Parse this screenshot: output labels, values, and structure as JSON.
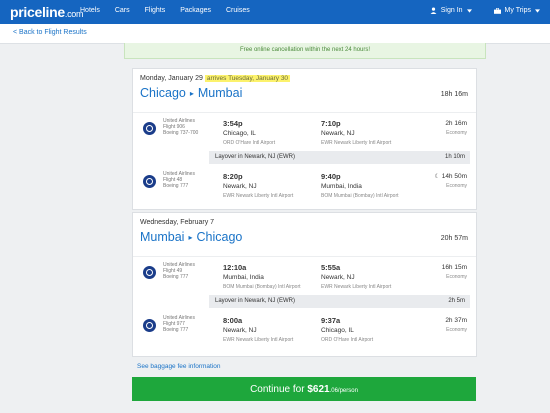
{
  "topbar": {
    "logo": "priceline",
    "logo_suffix": ".com",
    "nav": [
      "Hotels",
      "Cars",
      "Flights",
      "Packages",
      "Cruises"
    ],
    "sign_in": "Sign In",
    "my_trips": "My Trips",
    "color": "#1565c0"
  },
  "subbar": {
    "back": "< Back to Flight Results"
  },
  "notice": "Free online cancellation within the next 24 hours!",
  "trips": [
    {
      "date": "Monday, January 29",
      "arrives": "arrives Tuesday, January 30",
      "from": "Chicago",
      "to": "Mumbai",
      "total": "18h 16m",
      "segments": [
        {
          "airline": "United Airlines",
          "flight": "Flight 906",
          "aircraft": "Boeing 737-700",
          "dep_time": "3:54p",
          "dep_city": "Chicago, IL",
          "dep_airport": "ORD O'Hare Intl Airport",
          "arr_time": "7:10p",
          "arr_city": "Newark, NJ",
          "arr_airport": "EWR Newark Liberty Intl Airport",
          "duration": "2h 16m",
          "cabin": "Economy",
          "overnight": false
        },
        {
          "airline": "United Airlines",
          "flight": "Flight 48",
          "aircraft": "Boeing 777",
          "dep_time": "8:20p",
          "dep_city": "Newark, NJ",
          "dep_airport": "EWR Newark Liberty Intl Airport",
          "arr_time": "9:40p",
          "arr_city": "Mumbai, India",
          "arr_airport": "BOM Mumbai (Bombay) Intl Airport",
          "duration": "14h 50m",
          "cabin": "Economy",
          "overnight": true
        }
      ],
      "layover": {
        "text": "Layover in Newark, NJ (EWR)",
        "duration": "1h 10m"
      }
    },
    {
      "date": "Wednesday, February 7",
      "arrives": "",
      "from": "Mumbai",
      "to": "Chicago",
      "total": "20h 57m",
      "segments": [
        {
          "airline": "United Airlines",
          "flight": "Flight 49",
          "aircraft": "Boeing 777",
          "dep_time": "12:10a",
          "dep_city": "Mumbai, India",
          "dep_airport": "BOM Mumbai (Bombay) Intl Airport",
          "arr_time": "5:55a",
          "arr_city": "Newark, NJ",
          "arr_airport": "EWR Newark Liberty Intl Airport",
          "duration": "16h 15m",
          "cabin": "Economy",
          "overnight": false
        },
        {
          "airline": "United Airlines",
          "flight": "Flight 977",
          "aircraft": "Boeing 777",
          "dep_time": "8:00a",
          "dep_city": "Newark, NJ",
          "dep_airport": "EWR Newark Liberty Intl Airport",
          "arr_time": "9:37a",
          "arr_city": "Chicago, IL",
          "arr_airport": "ORD O'Hare Intl Airport",
          "duration": "2h 37m",
          "cabin": "Economy",
          "overnight": false
        }
      ],
      "layover": {
        "text": "Layover in Newark, NJ (EWR)",
        "duration": "2h 5m"
      }
    }
  ],
  "baggage_link": "See baggage fee information",
  "cta": {
    "prefix": "Continue for ",
    "amount": "$621",
    "cents": ".06/person",
    "color": "#1ea73c"
  },
  "icons": {
    "user": "user-icon",
    "trips": "briefcase-icon",
    "moon": "moon-icon",
    "airline": "united-logo"
  }
}
